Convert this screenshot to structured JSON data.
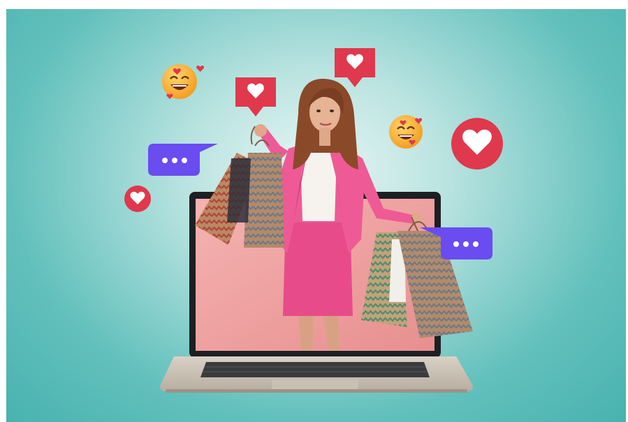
{
  "image": {
    "colors": {
      "background_inner": "#e8f6f5",
      "background_outer": "#49b2af",
      "heart_red": "#e0384d",
      "chat_purple": "#6a4cf0",
      "outfit_pink": "#e84b8a",
      "laptop_silver": "#cfc7bd",
      "screen_pink": "#f0a3a2"
    },
    "icons": [
      "emoji-smile-hearts-icon",
      "emoji-smile-hearts-icon",
      "heart-notification-icon",
      "heart-notification-icon",
      "heart-circle-icon",
      "heart-circle-icon",
      "chat-typing-bubble-icon",
      "chat-typing-bubble-icon"
    ]
  }
}
